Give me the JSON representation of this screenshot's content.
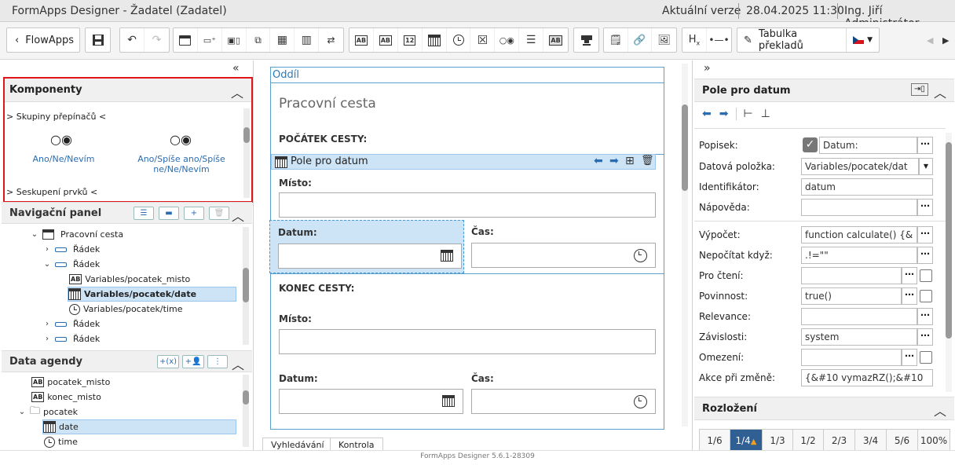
{
  "titlebar": {
    "title": "FormApps Designer - Žadatel (Zadatel)",
    "version": "Aktuální verze",
    "datetime": "28.04.2025 11:30",
    "user": "Ing. Jiří Administrátor"
  },
  "toolbar": {
    "flowapps_label": "FlowApps",
    "translations_label": "Tabulka překladů",
    "ab_glyph": "AB",
    "num_glyph": "12",
    "h_glyph": "H",
    "h_sub": "x"
  },
  "components": {
    "title": "Komponenty",
    "group1": "> Skupiny přepínačů <",
    "item1_glyph": "○◉",
    "item1_label": "Ano/Ne/Nevím",
    "item2_glyph": "○◉",
    "item2_label": "Ano/Spíše ano/Spíše ne/Ne/Nevím",
    "group2": "> Seskupení prvků <"
  },
  "nav": {
    "title": "Navigační panel",
    "items": [
      {
        "label": "Pracovní cesta"
      },
      {
        "label": "Řádek"
      },
      {
        "label": "Řádek"
      },
      {
        "label": "Variables/pocatek_misto"
      },
      {
        "label": "Variables/pocatek/date"
      },
      {
        "label": "Variables/pocatek/time"
      },
      {
        "label": "Řádek"
      },
      {
        "label": "Řádek"
      }
    ]
  },
  "agenda": {
    "title": "Data agendy",
    "btn1": "+(x)",
    "items": [
      {
        "label": "pocatek_misto"
      },
      {
        "label": "konec_misto"
      },
      {
        "label": "pocatek"
      },
      {
        "label": "date"
      },
      {
        "label": "time"
      }
    ]
  },
  "canvas": {
    "section_label": "Oddíl",
    "heading": "Pracovní cesta",
    "start_title": "POČÁTEK CESTY:",
    "selected_component": "Pole pro datum",
    "place_label": "Místo:",
    "date_label": "Datum:",
    "time_label": "Čas:",
    "end_title": "KONEC CESTY:",
    "place_label2": "Místo:",
    "date_label2": "Datum:",
    "time_label2": "Čas:"
  },
  "bottom_tabs": {
    "search": "Vyhledávání",
    "check": "Kontrola"
  },
  "properties": {
    "title": "Pole pro datum",
    "rows": [
      {
        "label": "Popisek:",
        "value": "Datum:"
      },
      {
        "label": "Datová položka:",
        "value": "Variables/pocatek/dat"
      },
      {
        "label": "Identifikátor:",
        "value": "datum"
      },
      {
        "label": "Nápověda:",
        "value": ""
      },
      {
        "label": "Výpočet:",
        "value": "function calculate() {&"
      },
      {
        "label": "Nepočítat když:",
        "value": ".!=\"\""
      },
      {
        "label": "Pro čtení:",
        "value": ""
      },
      {
        "label": "Povinnost:",
        "value": "true()"
      },
      {
        "label": "Relevance:",
        "value": ""
      },
      {
        "label": "Závislosti:",
        "value": "system"
      },
      {
        "label": "Omezení:",
        "value": ""
      },
      {
        "label": "Akce při změně:",
        "value": "{&#10  vymazRZ();&#10"
      }
    ]
  },
  "layout": {
    "title": "Rozložení",
    "ratios": [
      "1/6",
      "1/4",
      "1/3",
      "1/2",
      "2/3",
      "3/4",
      "5/6",
      "100%"
    ]
  },
  "status": {
    "version": "FormApps Designer 5.6.1-28309"
  },
  "colors": {
    "accent": "#2b6cb0",
    "selection": "#cde4f7",
    "highlight_border": "#e0161b"
  }
}
